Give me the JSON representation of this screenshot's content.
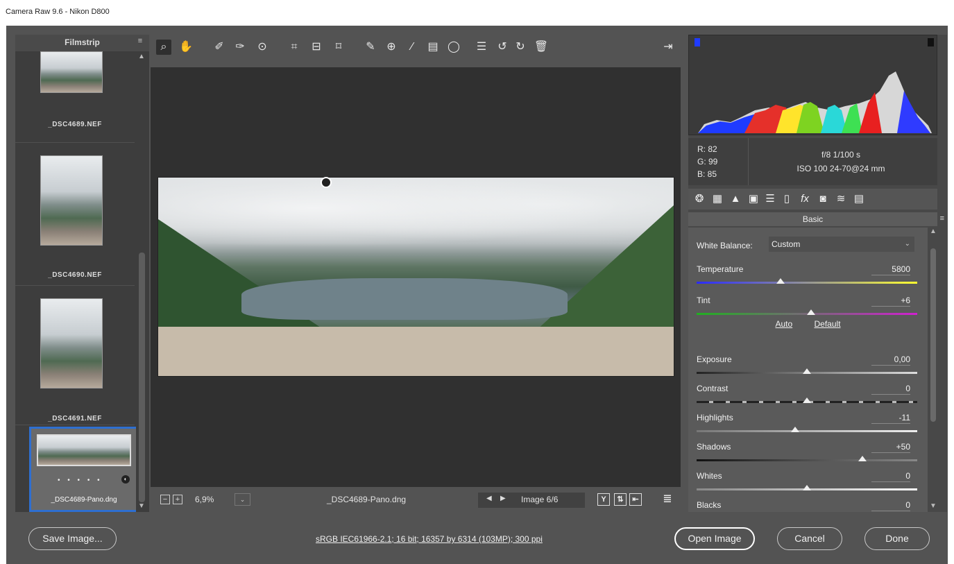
{
  "window": {
    "title": "Camera Raw 9.6  -  Nikon D800"
  },
  "filmstrip": {
    "header": "Filmstrip",
    "items": [
      {
        "name": "_DSC4689.NEF"
      },
      {
        "name": "_DSC4690.NEF"
      },
      {
        "name": "_DSC4691.NEF"
      },
      {
        "name": "_DSC4689-Pano.dng",
        "selected": true,
        "dots": "• • • • •"
      }
    ]
  },
  "toolbar": {
    "tools": [
      "zoom-tool",
      "hand-tool",
      "white-balance-tool",
      "color-sampler-tool",
      "targeted-adjustment-tool",
      "crop-tool",
      "straighten-tool",
      "transform-tool",
      "spot-removal-tool",
      "red-eye-tool",
      "adjustment-brush",
      "graduated-filter",
      "radial-filter",
      "preferences",
      "rotate-left",
      "rotate-right",
      "delete",
      "toggle-fullscreen"
    ]
  },
  "status": {
    "zoom": "6,9%",
    "zoom_dropdown": "⌄",
    "filename": "_DSC4689-Pano.dng",
    "image_count": "Image 6/6",
    "y_label": "Y"
  },
  "readout": {
    "r": "R:   82",
    "g": "G:   99",
    "b": "B:   85",
    "aperture_shutter": "f/8   1/100 s",
    "iso_lens": "ISO 100   24-70@24 mm"
  },
  "panel": {
    "title": "Basic",
    "white_balance_label": "White Balance:",
    "white_balance_value": "Custom",
    "auto": "Auto",
    "default": "Default",
    "sliders": [
      {
        "label": "Temperature",
        "value": "5800",
        "fraction": 0.38
      },
      {
        "label": "Tint",
        "value": "+6",
        "fraction": 0.52
      },
      {
        "label": "Exposure",
        "value": "0,00",
        "fraction": 0.5
      },
      {
        "label": "Contrast",
        "value": "0",
        "fraction": 0.5
      },
      {
        "label": "Highlights",
        "value": "-11",
        "fraction": 0.445
      },
      {
        "label": "Shadows",
        "value": "+50",
        "fraction": 0.75
      },
      {
        "label": "Whites",
        "value": "0",
        "fraction": 0.5
      },
      {
        "label": "Blacks",
        "value": "0",
        "fraction": 0.5
      }
    ]
  },
  "bottom": {
    "save": "Save Image...",
    "info": "sRGB IEC61966-2.1; 16 bit; 16357 by 6314 (103MP); 300 ppi",
    "open": "Open Image",
    "cancel": "Cancel",
    "done": "Done"
  },
  "colors": {
    "selection": "#2e6fd1",
    "panel_bg": "#535353"
  }
}
